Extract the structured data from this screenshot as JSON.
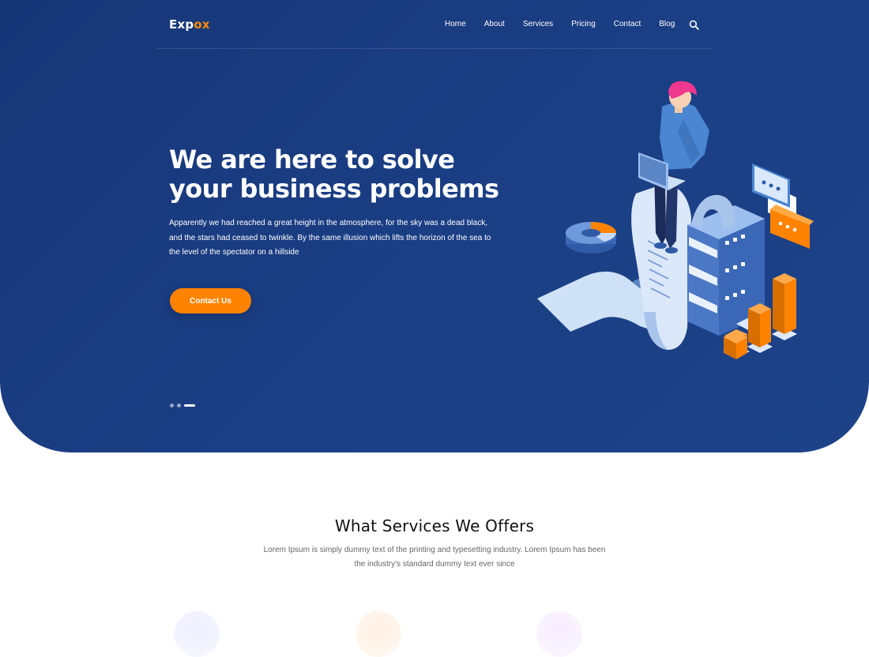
{
  "brand": {
    "logo_main": "Exp",
    "logo_accent": "ox"
  },
  "nav": {
    "items": [
      "Home",
      "About",
      "Services",
      "Pricing",
      "Contact",
      "Blog"
    ]
  },
  "hero": {
    "title_line1": "We are here to solve",
    "title_line2": "your business problems",
    "description": "Apparently we had reached a great height in the atmosphere, for the sky was a dead black, and the stars had ceased to twinkle. By the same illusion which lifts the horizon of the sea to the level of the spectator on a hillside",
    "cta_label": "Contact Us",
    "slides": {
      "total": 3,
      "active": 3
    }
  },
  "services": {
    "title": "What Services We Offers",
    "description": "Lorem Ipsum is simply dummy text of the printing and typesetting industry. Lorem Ipsum has been the industry's standard dummy text ever since"
  },
  "colors": {
    "hero_bg": "#1b3f85",
    "accent": "#ff8300",
    "text_light": "#ffffff",
    "text_dark": "#111111",
    "text_muted": "#666666"
  },
  "icons": {
    "search": "search-icon"
  }
}
